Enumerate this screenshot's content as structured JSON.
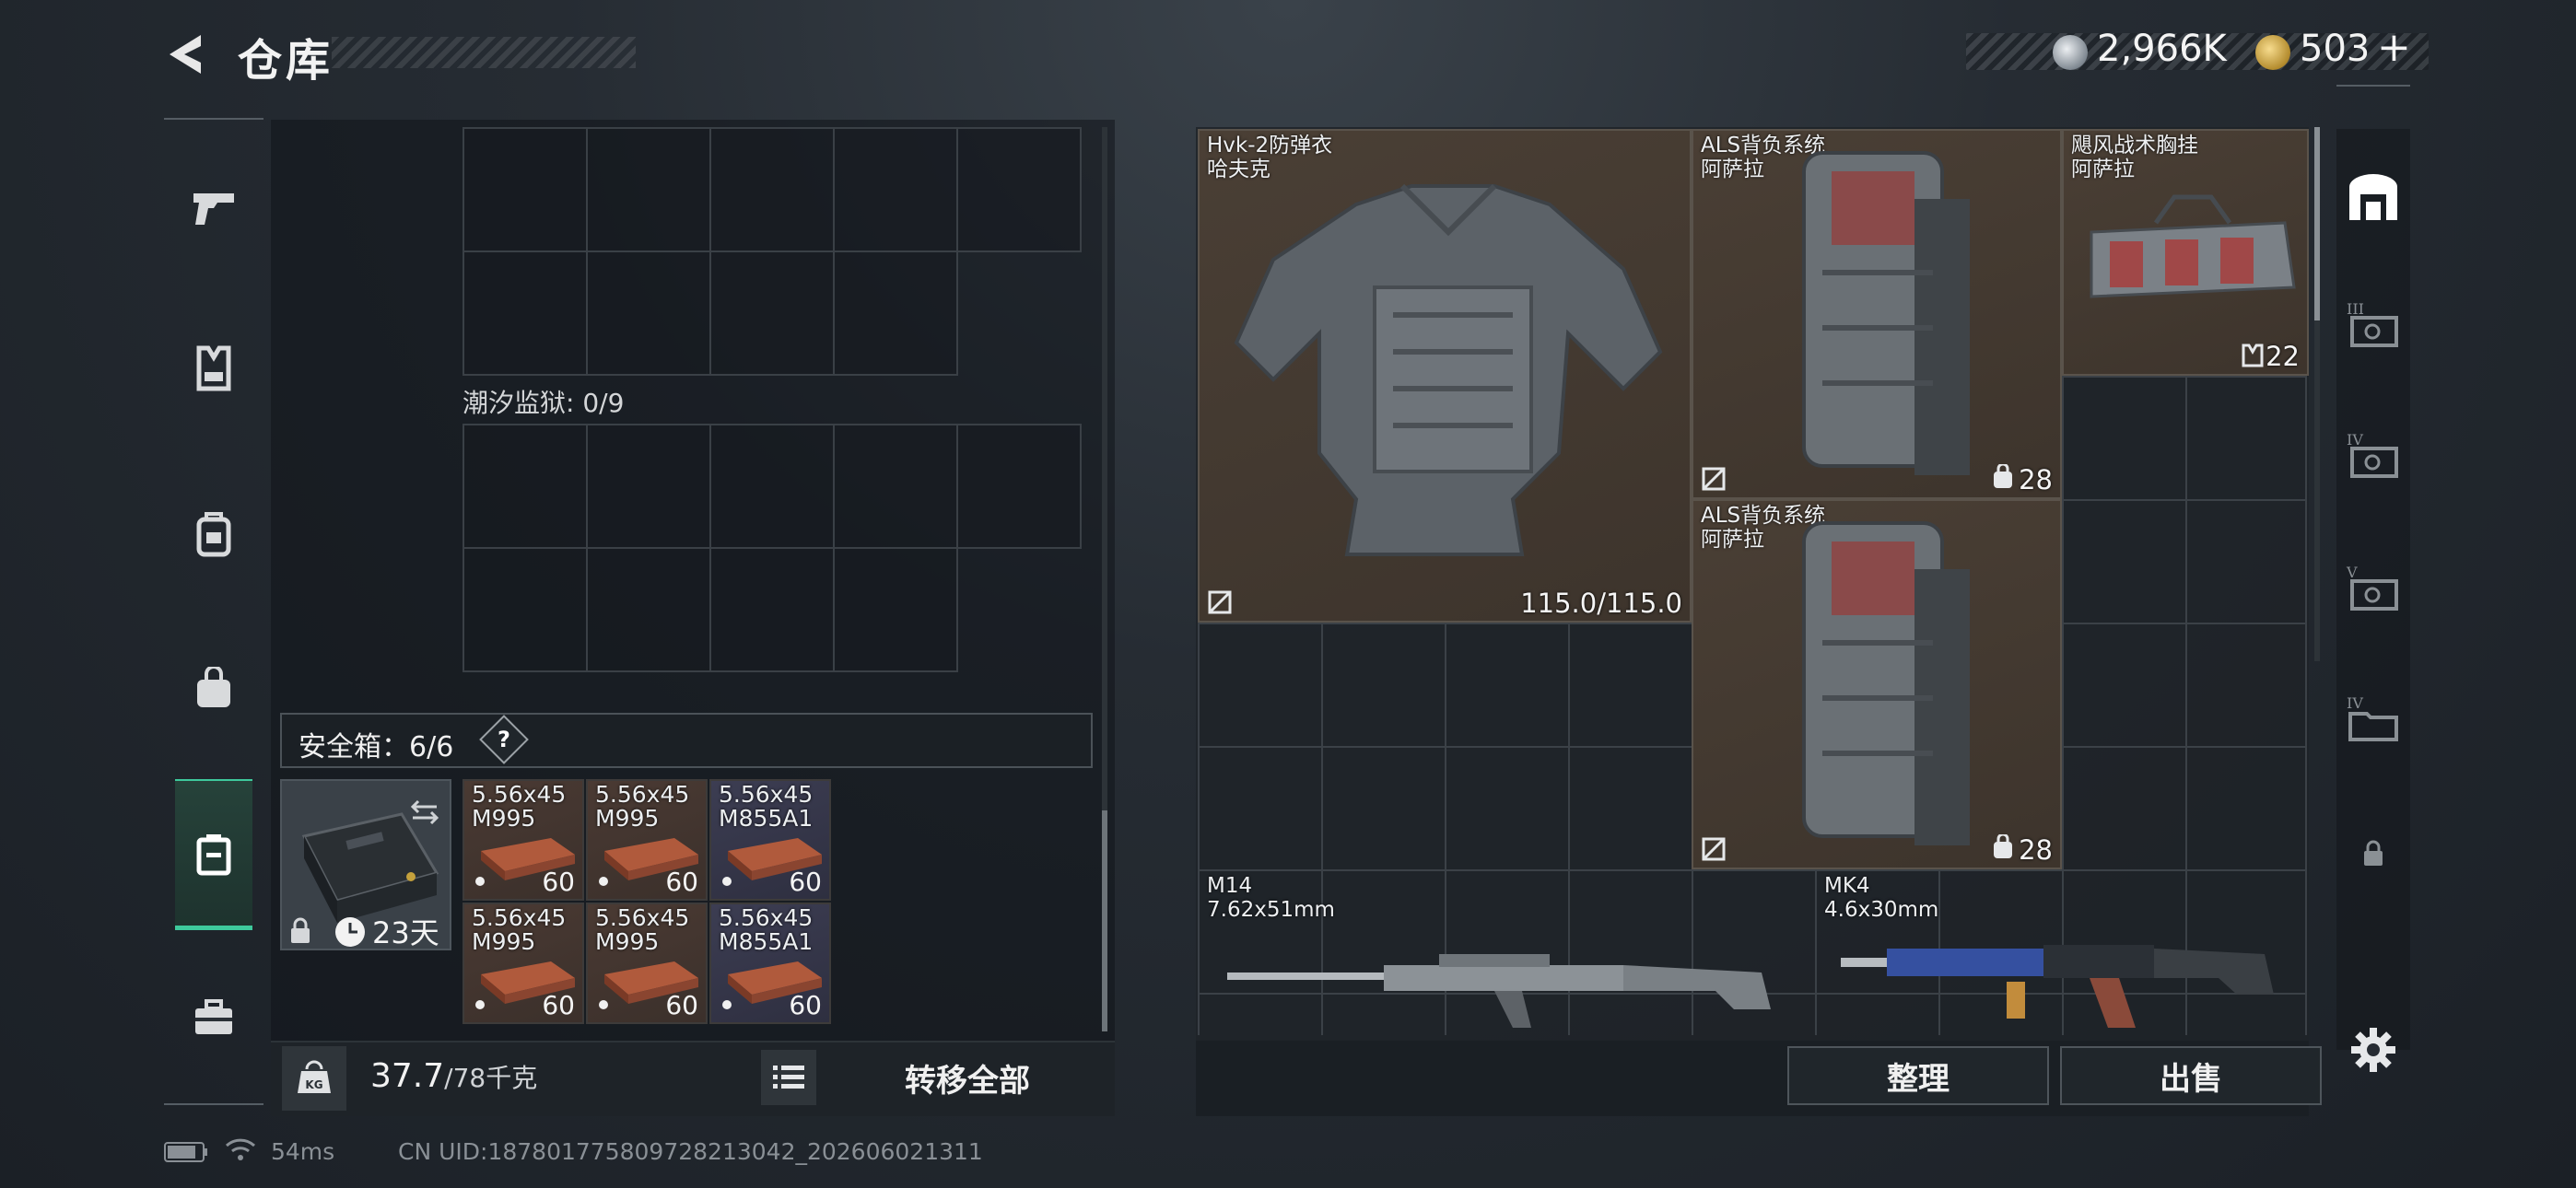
{
  "header": {
    "title": "仓库",
    "silver_amount": "2,966K",
    "gold_amount": "503",
    "gold_plus": "+"
  },
  "sidebar": {
    "items": [
      {
        "icon": "pistol-icon"
      },
      {
        "icon": "vest-icon"
      },
      {
        "icon": "backpack-icon"
      },
      {
        "icon": "bag-icon"
      },
      {
        "icon": "safe-case-icon",
        "active": true
      },
      {
        "icon": "briefcase-icon"
      }
    ]
  },
  "left_panel": {
    "prison_label": "潮汐监狱: 0/9",
    "safebox_label": "安全箱：6/6",
    "safebox_help": "?",
    "case_timer": "23天",
    "ammo": [
      {
        "line1": "5.56x45",
        "line2": "M995",
        "qty": "60",
        "color": "red"
      },
      {
        "line1": "5.56x45",
        "line2": "M995",
        "qty": "60",
        "color": "red"
      },
      {
        "line1": "5.56x45",
        "line2": "M855A1",
        "qty": "60",
        "color": "blue"
      },
      {
        "line1": "5.56x45",
        "line2": "M995",
        "qty": "60",
        "color": "red"
      },
      {
        "line1": "5.56x45",
        "line2": "M995",
        "qty": "60",
        "color": "red"
      },
      {
        "line1": "5.56x45",
        "line2": "M855A1",
        "qty": "60",
        "color": "blue"
      }
    ],
    "weight_current": "37.7",
    "weight_max": "/78千克",
    "kg_label": "KG",
    "transfer_all": "转移全部"
  },
  "right_panel": {
    "items": [
      {
        "name": "Hvk-2防弹衣",
        "sub": "哈夫克",
        "value": "115.0/115.0"
      },
      {
        "name": "ALS背负系统",
        "sub": "阿萨拉",
        "value": "28"
      },
      {
        "name": "飓风战术胸挂",
        "sub": "阿萨拉",
        "value": "22"
      },
      {
        "name": "ALS背负系统",
        "sub": "阿萨拉",
        "value": "28"
      },
      {
        "name": "M14",
        "sub": "7.62x51mm"
      },
      {
        "name": "MK4",
        "sub": "4.6x30mm"
      }
    ],
    "sort_button": "整理",
    "sell_button": "出售"
  },
  "right_tabs": [
    {
      "icon": "storage-home-icon",
      "active": true
    },
    {
      "icon": "storage-tier3-icon",
      "tier": "III"
    },
    {
      "icon": "storage-tier4-icon",
      "tier": "IV"
    },
    {
      "icon": "storage-tier5-icon",
      "tier": "V"
    },
    {
      "icon": "storage-folder-icon",
      "tier": "IV"
    },
    {
      "icon": "lock-icon"
    }
  ],
  "footer": {
    "ping": "54ms",
    "uid": "CN UID:18780177580972821304​2_202606021311"
  },
  "colors": {
    "accent": "#3ec99c",
    "item_brown": "#4a3f35",
    "ammo_blue": "#3c3d52"
  }
}
